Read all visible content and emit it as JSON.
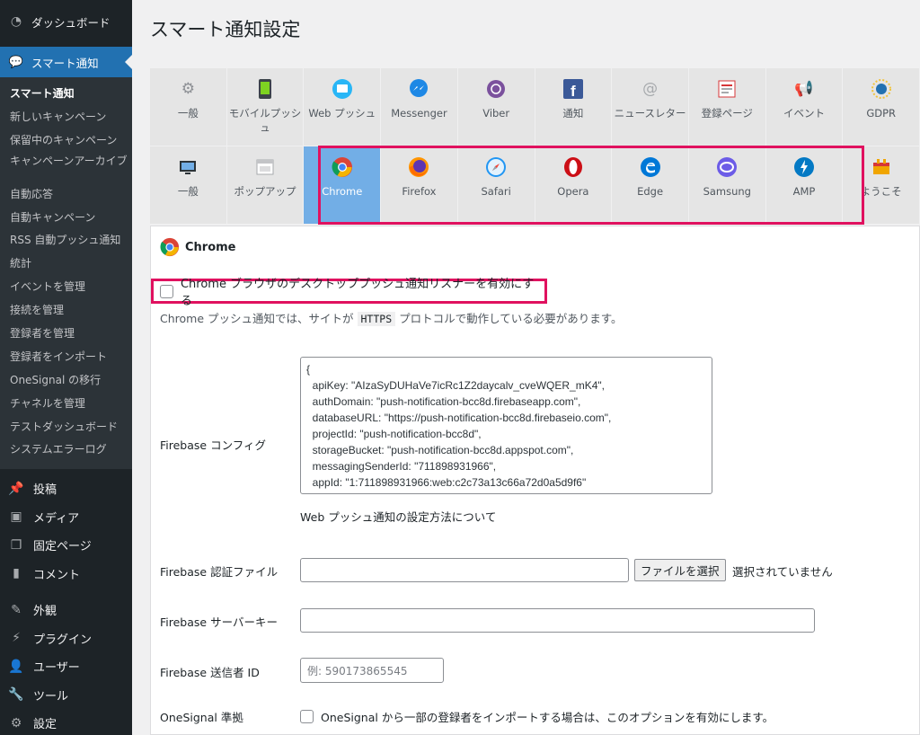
{
  "sidebar": {
    "dashboard": "ダッシュボード",
    "active_menu": "スマート通知",
    "submenu": [
      "スマート通知",
      "新しいキャンペーン",
      "保留中のキャンペーン",
      "キャンペーンアーカイブ",
      "自動応答",
      "自動キャンペーン",
      "RSS 自動プッシュ通知",
      "統計",
      "イベントを管理",
      "接続を管理",
      "登録者を管理",
      "登録者をインポート",
      "OneSignal の移行",
      "チャネルを管理",
      "テストダッシュボード",
      "システムエラーログ"
    ],
    "menu": [
      "投稿",
      "メディア",
      "固定ページ",
      "コメント",
      "外観",
      "プラグイン",
      "ユーザー",
      "ツール",
      "設定"
    ]
  },
  "page": {
    "title": "スマート通知設定"
  },
  "tabs_row1": [
    {
      "label": "一般",
      "icon": "gears-icon"
    },
    {
      "label": "モバイルプッシュ",
      "icon": "mobile-icon"
    },
    {
      "label": "Web プッシュ",
      "icon": "monitor-icon"
    },
    {
      "label": "Messenger",
      "icon": "messenger-icon"
    },
    {
      "label": "Viber",
      "icon": "viber-icon"
    },
    {
      "label": "通知",
      "icon": "facebook-icon"
    },
    {
      "label": "ニュースレター",
      "icon": "at-icon"
    },
    {
      "label": "登録ページ",
      "icon": "form-icon"
    },
    {
      "label": "イベント",
      "icon": "megaphone-icon"
    },
    {
      "label": "GDPR",
      "icon": "gdpr-icon"
    }
  ],
  "tabs_row2": [
    {
      "label": "一般",
      "icon": "desktop-gear-icon"
    },
    {
      "label": "ポップアップ",
      "icon": "popup-icon"
    },
    {
      "label": "Chrome",
      "icon": "chrome-icon"
    },
    {
      "label": "Firefox",
      "icon": "firefox-icon"
    },
    {
      "label": "Safari",
      "icon": "safari-icon"
    },
    {
      "label": "Opera",
      "icon": "opera-icon"
    },
    {
      "label": "Edge",
      "icon": "edge-icon"
    },
    {
      "label": "Samsung",
      "icon": "samsung-icon"
    },
    {
      "label": "AMP",
      "icon": "amp-icon"
    },
    {
      "label": "ようこそ",
      "icon": "welcome-icon"
    }
  ],
  "panel": {
    "heading": "Chrome",
    "enable_label": "Chrome ブラウザのデスクトッププッシュ通知リスナーを有効にする",
    "https_note_pre": "Chrome プッシュ通知では、サイトが",
    "https_code": "HTTPS",
    "https_note_post": "プロトコルで動作している必要があります。",
    "config_label": "Firebase コンフィグ",
    "config_value": "{\n  apiKey: \"AIzaSyDUHaVe7icRc1Z2daycalv_cveWQER_mK4\",\n  authDomain: \"push-notification-bcc8d.firebaseapp.com\",\n  databaseURL: \"https://push-notification-bcc8d.firebaseio.com\",\n  projectId: \"push-notification-bcc8d\",\n  storageBucket: \"push-notification-bcc8d.appspot.com\",\n  messagingSenderId: \"711898931966\",\n  appId: \"1:711898931966:web:c2c73a13c66a72d0a5d9f6\"",
    "howto_link": "Web プッシュ通知の設定方法について",
    "auth_file_label": "Firebase 認証ファイル",
    "file_button": "ファイルを選択",
    "file_status": "選択されていません",
    "server_key_label": "Firebase サーバーキー",
    "sender_id_label": "Firebase 送信者 ID",
    "sender_id_placeholder": "例: 590173865545",
    "onesignal_label": "OneSignal 準拠",
    "onesignal_option": "OneSignal から一部の登録者をインポートする場合は、このオプションを有効にします。"
  }
}
